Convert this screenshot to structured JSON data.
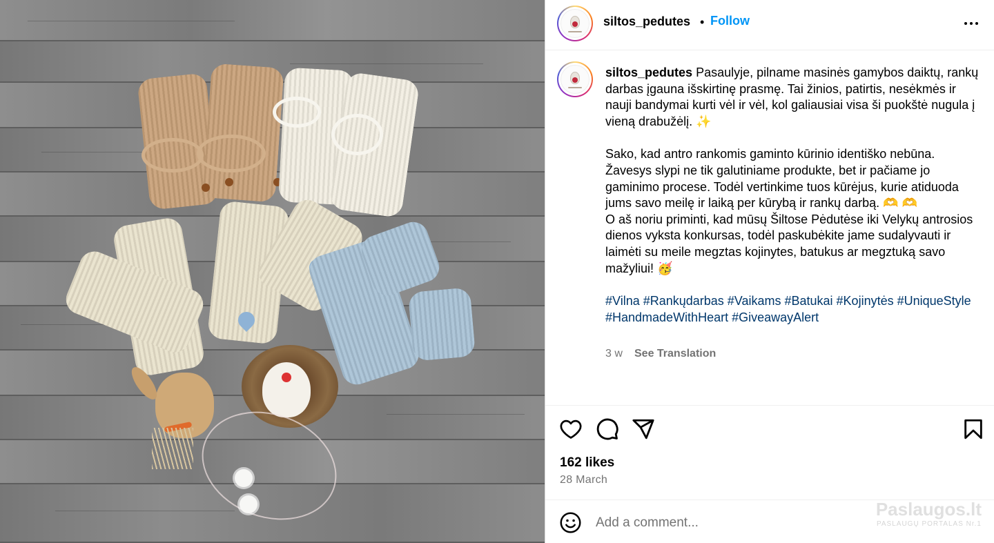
{
  "post": {
    "image_alt": "Knitted baby booties and socks with Easter decorations on wooden floor",
    "username": "siltos_pedutes",
    "separator": "•",
    "follow_label": "Follow",
    "caption": {
      "username": "siltos_pedutes",
      "paragraph1": "Pasaulyje, pilname masinės gamybos daiktų, rankų darbas įgauna išskirtinę prasmę. Tai žinios, patirtis, nesėkmės ir nauji bandymai kurti vėl ir vėl, kol galiausiai visa ši puokštė nugula į vieną drabužėlį. ✨",
      "paragraph2": "Sako, kad antro rankomis gaminto kūrinio identiško nebūna. Žavesys slypi ne tik galutiniame produkte, bet ir pačiame jo gaminimo procese. Todėl vertinkime tuos kūrėjus, kurie atiduoda jums savo meilę ir laiką per kūrybą ir rankų darbą. 🫶 🫶",
      "paragraph3": "O aš noriu priminti, kad mūsų Šiltose Pėdutėse iki Velykų antrosios dienos vyksta konkursas, todėl paskubėkite jame sudalyvauti ir laimėti su meile megztas kojinytes, batukus ar megztuką savo mažyliui! 🥳",
      "hashtags": "#Vilna #Rankųdarbas #Vaikams #Batukai #Kojinytės #UniqueStyle #HandmadeWithHeart #GiveawayAlert"
    },
    "age": "3 w",
    "see_translation": "See Translation",
    "likes": "162 likes",
    "date": "28 March",
    "comment_placeholder": "Add a comment..."
  },
  "icons": {
    "more": "more-options-icon",
    "like": "heart-icon",
    "comment": "comment-icon",
    "share": "share-icon",
    "save": "bookmark-icon",
    "emoji": "emoji-icon"
  },
  "watermark": {
    "title": "Paslaugos.lt",
    "subtitle": "PASLAUGŲ PORTALAS Nr.1"
  },
  "colors": {
    "link_blue": "#0095f6",
    "hashtag": "#00376b",
    "muted": "#737373",
    "border": "#dbdbdb"
  }
}
